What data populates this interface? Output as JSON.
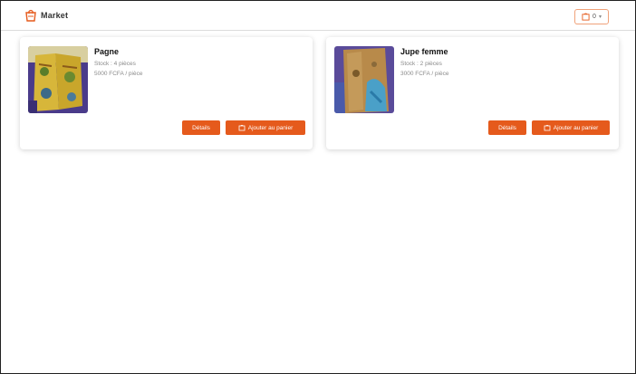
{
  "header": {
    "logo_text": "Market",
    "cart_count": "0"
  },
  "products": [
    {
      "title": "Pagne",
      "meta_line1": "Stock : 4 pièces",
      "meta_line2": "5000 FCFA / pièce",
      "details_label": "Détails",
      "add_label": "Ajouter au panier"
    },
    {
      "title": "Jupe femme",
      "meta_line1": "Stock : 2 pièces",
      "meta_line2": "3000 FCFA / pièce",
      "details_label": "Détails",
      "add_label": "Ajouter au panier"
    }
  ],
  "colors": {
    "accent": "#e55a1c"
  }
}
